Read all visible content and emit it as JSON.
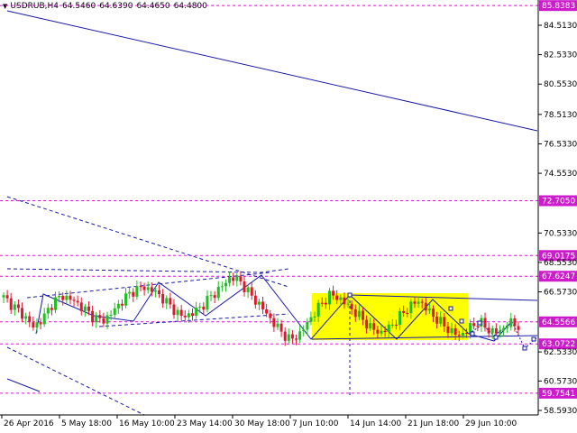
{
  "header": {
    "symbol": "USDRUB,H4",
    "open": "64.5460",
    "high": "64.6390",
    "low": "64.4650",
    "close": "64.4800"
  },
  "colors": {
    "background": "#ffffff",
    "bull_candle": "#1fbf1f",
    "bear_candle": "#e0182d",
    "trend_lines": "#1a1aa8",
    "level_lines": "#cc1ccc",
    "highlight_rect": "#ffff00",
    "price_tag_bg": "#cc1ccc"
  },
  "price_axis": {
    "ticks": [
      "84.5130",
      "82.5330",
      "80.5530",
      "78.5130",
      "76.5330",
      "74.5530",
      "70.5330",
      "68.5530",
      "66.5730",
      "62.5330",
      "60.5730",
      "58.5930"
    ]
  },
  "price_tags": [
    "85.8383",
    "72.7050",
    "69.0175",
    "67.6247",
    "64.5566",
    "63.0722",
    "59.7541"
  ],
  "time_axis": {
    "labels": [
      "26 Apr 2016",
      "5 May 18:00",
      "16 May 10:00",
      "23 May 14:00",
      "30 May 18:00",
      "7 Jun 10:00",
      "14 Jun 14:00",
      "21 Jun 18:00",
      "29 Jun 10:00"
    ]
  },
  "chart_data": {
    "type": "candlestick",
    "instrument": "USDRUB",
    "timeframe": "H4",
    "ylim": [
      58.5,
      86.2
    ],
    "horizontal_levels": [
      85.8383,
      72.705,
      69.0175,
      67.6247,
      64.5566,
      63.0722,
      59.7541
    ],
    "x_labels": [
      "26 Apr 2016",
      "5 May 18:00",
      "16 May 10:00",
      "23 May 14:00",
      "30 May 18:00",
      "7 Jun 10:00",
      "14 Jun 14:00",
      "21 Jun 18:00",
      "29 Jun 10:00"
    ],
    "close_path": [
      66.2,
      65.6,
      65.0,
      64.2,
      64.8,
      65.9,
      66.3,
      66.0,
      65.5,
      64.9,
      64.6,
      65.2,
      66.0,
      66.6,
      66.9,
      66.7,
      66.2,
      65.5,
      64.9,
      65.1,
      65.6,
      66.3,
      66.9,
      67.6,
      67.2,
      66.3,
      65.6,
      64.7,
      63.9,
      63.3,
      63.8,
      64.8,
      65.7,
      66.4,
      66.1,
      65.5,
      64.9,
      64.2,
      63.8,
      64.2,
      64.9,
      65.6,
      66.0,
      65.2,
      64.6,
      64.0,
      63.6,
      64.1,
      64.6,
      64.0,
      63.8,
      64.5,
      64.3
    ]
  }
}
